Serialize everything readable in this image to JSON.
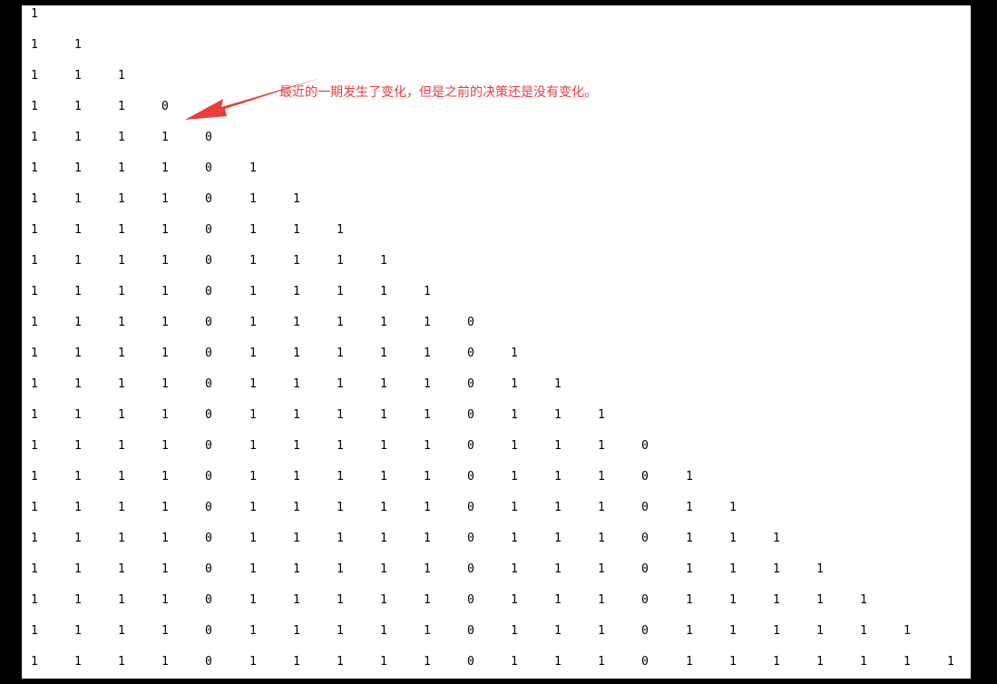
{
  "triangle": {
    "rows": [
      [
        "1"
      ],
      [
        "1",
        "1"
      ],
      [
        "1",
        "1",
        "1"
      ],
      [
        "1",
        "1",
        "1",
        "0"
      ],
      [
        "1",
        "1",
        "1",
        "1",
        "0"
      ],
      [
        "1",
        "1",
        "1",
        "1",
        "0",
        "1"
      ],
      [
        "1",
        "1",
        "1",
        "1",
        "0",
        "1",
        "1"
      ],
      [
        "1",
        "1",
        "1",
        "1",
        "0",
        "1",
        "1",
        "1"
      ],
      [
        "1",
        "1",
        "1",
        "1",
        "0",
        "1",
        "1",
        "1",
        "1"
      ],
      [
        "1",
        "1",
        "1",
        "1",
        "0",
        "1",
        "1",
        "1",
        "1",
        "1"
      ],
      [
        "1",
        "1",
        "1",
        "1",
        "0",
        "1",
        "1",
        "1",
        "1",
        "1",
        "0"
      ],
      [
        "1",
        "1",
        "1",
        "1",
        "0",
        "1",
        "1",
        "1",
        "1",
        "1",
        "0",
        "1"
      ],
      [
        "1",
        "1",
        "1",
        "1",
        "0",
        "1",
        "1",
        "1",
        "1",
        "1",
        "0",
        "1",
        "1"
      ],
      [
        "1",
        "1",
        "1",
        "1",
        "0",
        "1",
        "1",
        "1",
        "1",
        "1",
        "0",
        "1",
        "1",
        "1"
      ],
      [
        "1",
        "1",
        "1",
        "1",
        "0",
        "1",
        "1",
        "1",
        "1",
        "1",
        "0",
        "1",
        "1",
        "1",
        "0"
      ],
      [
        "1",
        "1",
        "1",
        "1",
        "0",
        "1",
        "1",
        "1",
        "1",
        "1",
        "0",
        "1",
        "1",
        "1",
        "0",
        "1"
      ],
      [
        "1",
        "1",
        "1",
        "1",
        "0",
        "1",
        "1",
        "1",
        "1",
        "1",
        "0",
        "1",
        "1",
        "1",
        "0",
        "1",
        "1"
      ],
      [
        "1",
        "1",
        "1",
        "1",
        "0",
        "1",
        "1",
        "1",
        "1",
        "1",
        "0",
        "1",
        "1",
        "1",
        "0",
        "1",
        "1",
        "1"
      ],
      [
        "1",
        "1",
        "1",
        "1",
        "0",
        "1",
        "1",
        "1",
        "1",
        "1",
        "0",
        "1",
        "1",
        "1",
        "0",
        "1",
        "1",
        "1",
        "1"
      ],
      [
        "1",
        "1",
        "1",
        "1",
        "0",
        "1",
        "1",
        "1",
        "1",
        "1",
        "0",
        "1",
        "1",
        "1",
        "0",
        "1",
        "1",
        "1",
        "1",
        "1"
      ],
      [
        "1",
        "1",
        "1",
        "1",
        "0",
        "1",
        "1",
        "1",
        "1",
        "1",
        "0",
        "1",
        "1",
        "1",
        "0",
        "1",
        "1",
        "1",
        "1",
        "1",
        "1"
      ],
      [
        "1",
        "1",
        "1",
        "1",
        "0",
        "1",
        "1",
        "1",
        "1",
        "1",
        "0",
        "1",
        "1",
        "1",
        "0",
        "1",
        "1",
        "1",
        "1",
        "1",
        "1",
        "1"
      ]
    ]
  },
  "annotation": {
    "text": "最近的一期发生了变化，但是之前的决策还是没有变化。",
    "color": "#ee3b3b"
  }
}
